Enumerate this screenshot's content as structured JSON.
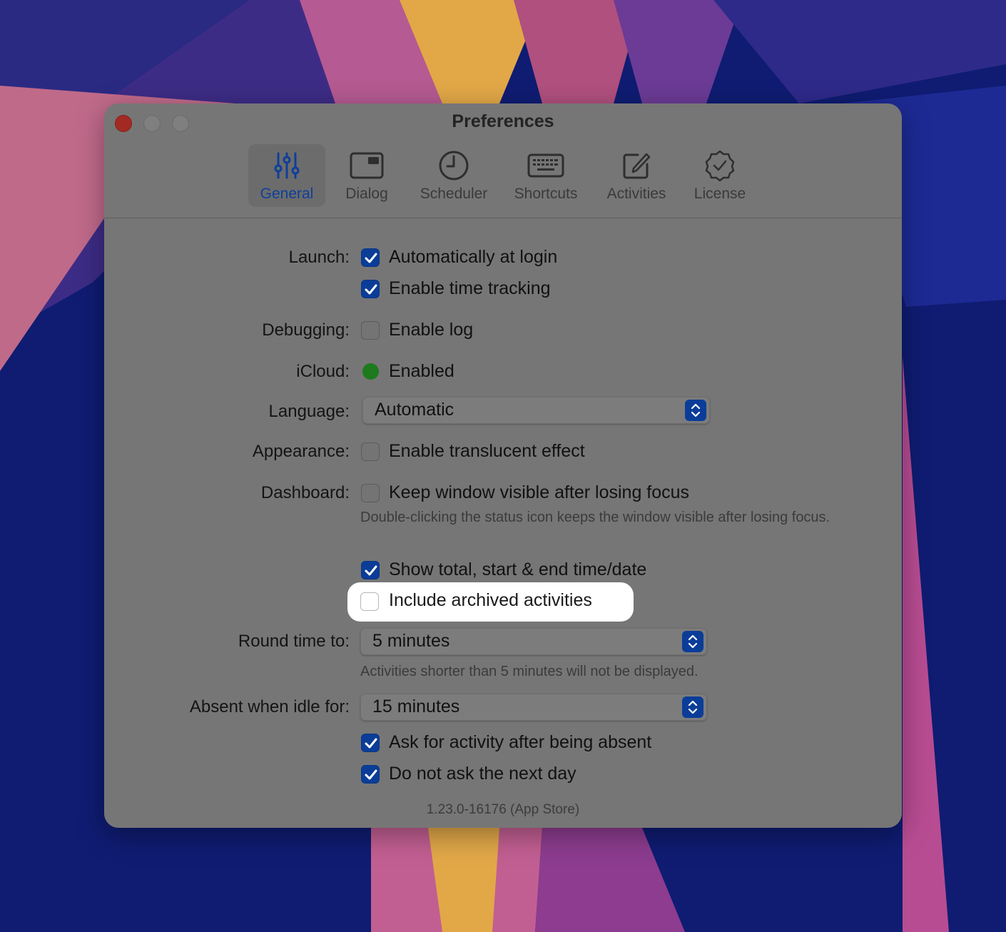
{
  "window": {
    "title": "Preferences"
  },
  "tabs": [
    {
      "label": "General",
      "icon": "sliders-icon",
      "selected": true
    },
    {
      "label": "Dialog",
      "icon": "window-icon",
      "selected": false
    },
    {
      "label": "Scheduler",
      "icon": "clock-icon",
      "selected": false
    },
    {
      "label": "Shortcuts",
      "icon": "keyboard-icon",
      "selected": false
    },
    {
      "label": "Activities",
      "icon": "compose-icon",
      "selected": false
    },
    {
      "label": "License",
      "icon": "seal-check-icon",
      "selected": false
    }
  ],
  "settings": {
    "launch": {
      "label": "Launch:",
      "auto_login": {
        "text": "Automatically at login",
        "checked": true
      },
      "time_tracking": {
        "text": "Enable time tracking",
        "checked": true
      }
    },
    "debugging": {
      "label": "Debugging:",
      "enable_log": {
        "text": "Enable log",
        "checked": false
      }
    },
    "icloud": {
      "label": "iCloud:",
      "status": "Enabled",
      "status_color": "#1d7a1d"
    },
    "language": {
      "label": "Language:",
      "value": "Automatic"
    },
    "appearance": {
      "label": "Appearance:",
      "translucent": {
        "text": "Enable translucent effect",
        "checked": false
      }
    },
    "dashboard": {
      "label": "Dashboard:",
      "keep_visible": {
        "text": "Keep window visible after losing focus",
        "checked": false
      },
      "note": "Double-clicking the status icon keeps the window visible after losing focus.",
      "show_totals": {
        "text": "Show total, start & end time/date",
        "checked": true
      },
      "include_archived": {
        "text": "Include archived activities",
        "checked": false
      }
    },
    "round_time": {
      "label": "Round time to:",
      "value": "5 minutes",
      "note": "Activities shorter than 5 minutes will not be displayed."
    },
    "absent_idle": {
      "label": "Absent when idle for:",
      "value": "15 minutes",
      "ask_after_absent": {
        "text": "Ask for activity after being absent",
        "checked": true
      },
      "not_next_day": {
        "text": "Do not ask the next day",
        "checked": true
      }
    }
  },
  "version": "1.23.0-16176 (App Store)",
  "colors": {
    "accent": "#0b3d98",
    "highlight": "#ffffff"
  }
}
